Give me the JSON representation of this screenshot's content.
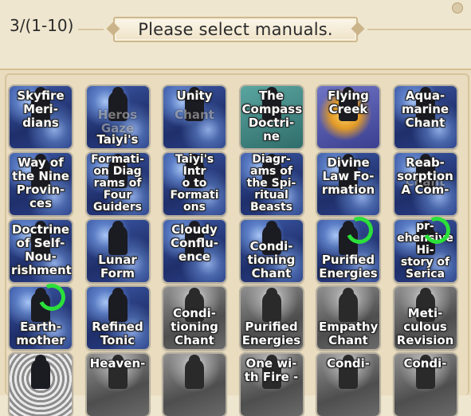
{
  "header": {
    "counter": "3/(1-10)",
    "title": "Please select manuals."
  },
  "colors": {
    "background": "#efe6cf",
    "selection_ring": "#2be03a",
    "panel_border": "#d7c49b"
  },
  "manuals": [
    {
      "label": "Skyfire\nMeri-\ndians",
      "style": "blue",
      "selected": false
    },
    {
      "label": "Taiyi's",
      "ghost": "Heros\nGaze",
      "style": "blue",
      "selected": false
    },
    {
      "label": "Unity",
      "ghost": "Chant",
      "style": "blue",
      "selected": false
    },
    {
      "label": "The\nCompass\nDoctri-\nne",
      "style": "teal",
      "selected": false
    },
    {
      "label": "Flying\nCreek",
      "style": "gold",
      "selected": false
    },
    {
      "label": "Aqua-\nmarine\nChant",
      "style": "blue",
      "selected": false
    },
    {
      "label": "Way of\nthe Nine\nProvin-\nces",
      "style": "blue",
      "selected": false
    },
    {
      "label": "Formati-\non Diag\nrams of\nFour\nGuiders",
      "style": "blue",
      "selected": false
    },
    {
      "label": "Taiyi's\nIntr\no to\nFormati\nons",
      "style": "blue",
      "selected": false
    },
    {
      "label": "Diagr-\nams of\nthe Spi-\nritual\nBeasts",
      "style": "blue",
      "selected": false
    },
    {
      "label": "Divine\nLaw Fo-\nrmation",
      "style": "blue",
      "selected": false
    },
    {
      "label": "Reab-\nsorption\nA Com-",
      "ghost": "Chant",
      "style": "blue",
      "selected": false
    },
    {
      "label": "Doctrine\nof Self-\nNou-\nrishment",
      "style": "blue",
      "selected": false
    },
    {
      "label": "Lunar\nForm",
      "style": "blue",
      "selected": false
    },
    {
      "label": "Cloudy\nConflu-\nence",
      "style": "blue",
      "selected": false
    },
    {
      "label": "Condi-\ntioning\nChant",
      "style": "blue",
      "selected": false
    },
    {
      "label": "Purified\nEnergies",
      "style": "blue",
      "selected": true
    },
    {
      "label": "pr-\nehensive\nHi-\nstory of\nSerica",
      "style": "blue",
      "selected": true
    },
    {
      "label": "Earth-\nmother",
      "style": "blue",
      "selected": true
    },
    {
      "label": "Refined\nTonic",
      "style": "blue",
      "selected": false
    },
    {
      "label": "Condi-\ntioning\nChant",
      "style": "gray",
      "selected": false
    },
    {
      "label": "Purified\nEnergies",
      "style": "gray",
      "selected": false
    },
    {
      "label": "Empathy\nChant",
      "style": "gray",
      "selected": false
    },
    {
      "label": "Meti-\nculous\nRevision",
      "style": "gray",
      "selected": false
    },
    {
      "label": "",
      "style": "pattern",
      "selected": false
    },
    {
      "label": "Heaven-",
      "style": "gray",
      "selected": false
    },
    {
      "label": "",
      "style": "gray",
      "selected": false
    },
    {
      "label": "One wi-\nth Fire -",
      "style": "gray",
      "selected": false
    },
    {
      "label": "Condi-",
      "style": "gray",
      "selected": false
    },
    {
      "label": "Condi-",
      "style": "gray",
      "selected": false
    }
  ]
}
